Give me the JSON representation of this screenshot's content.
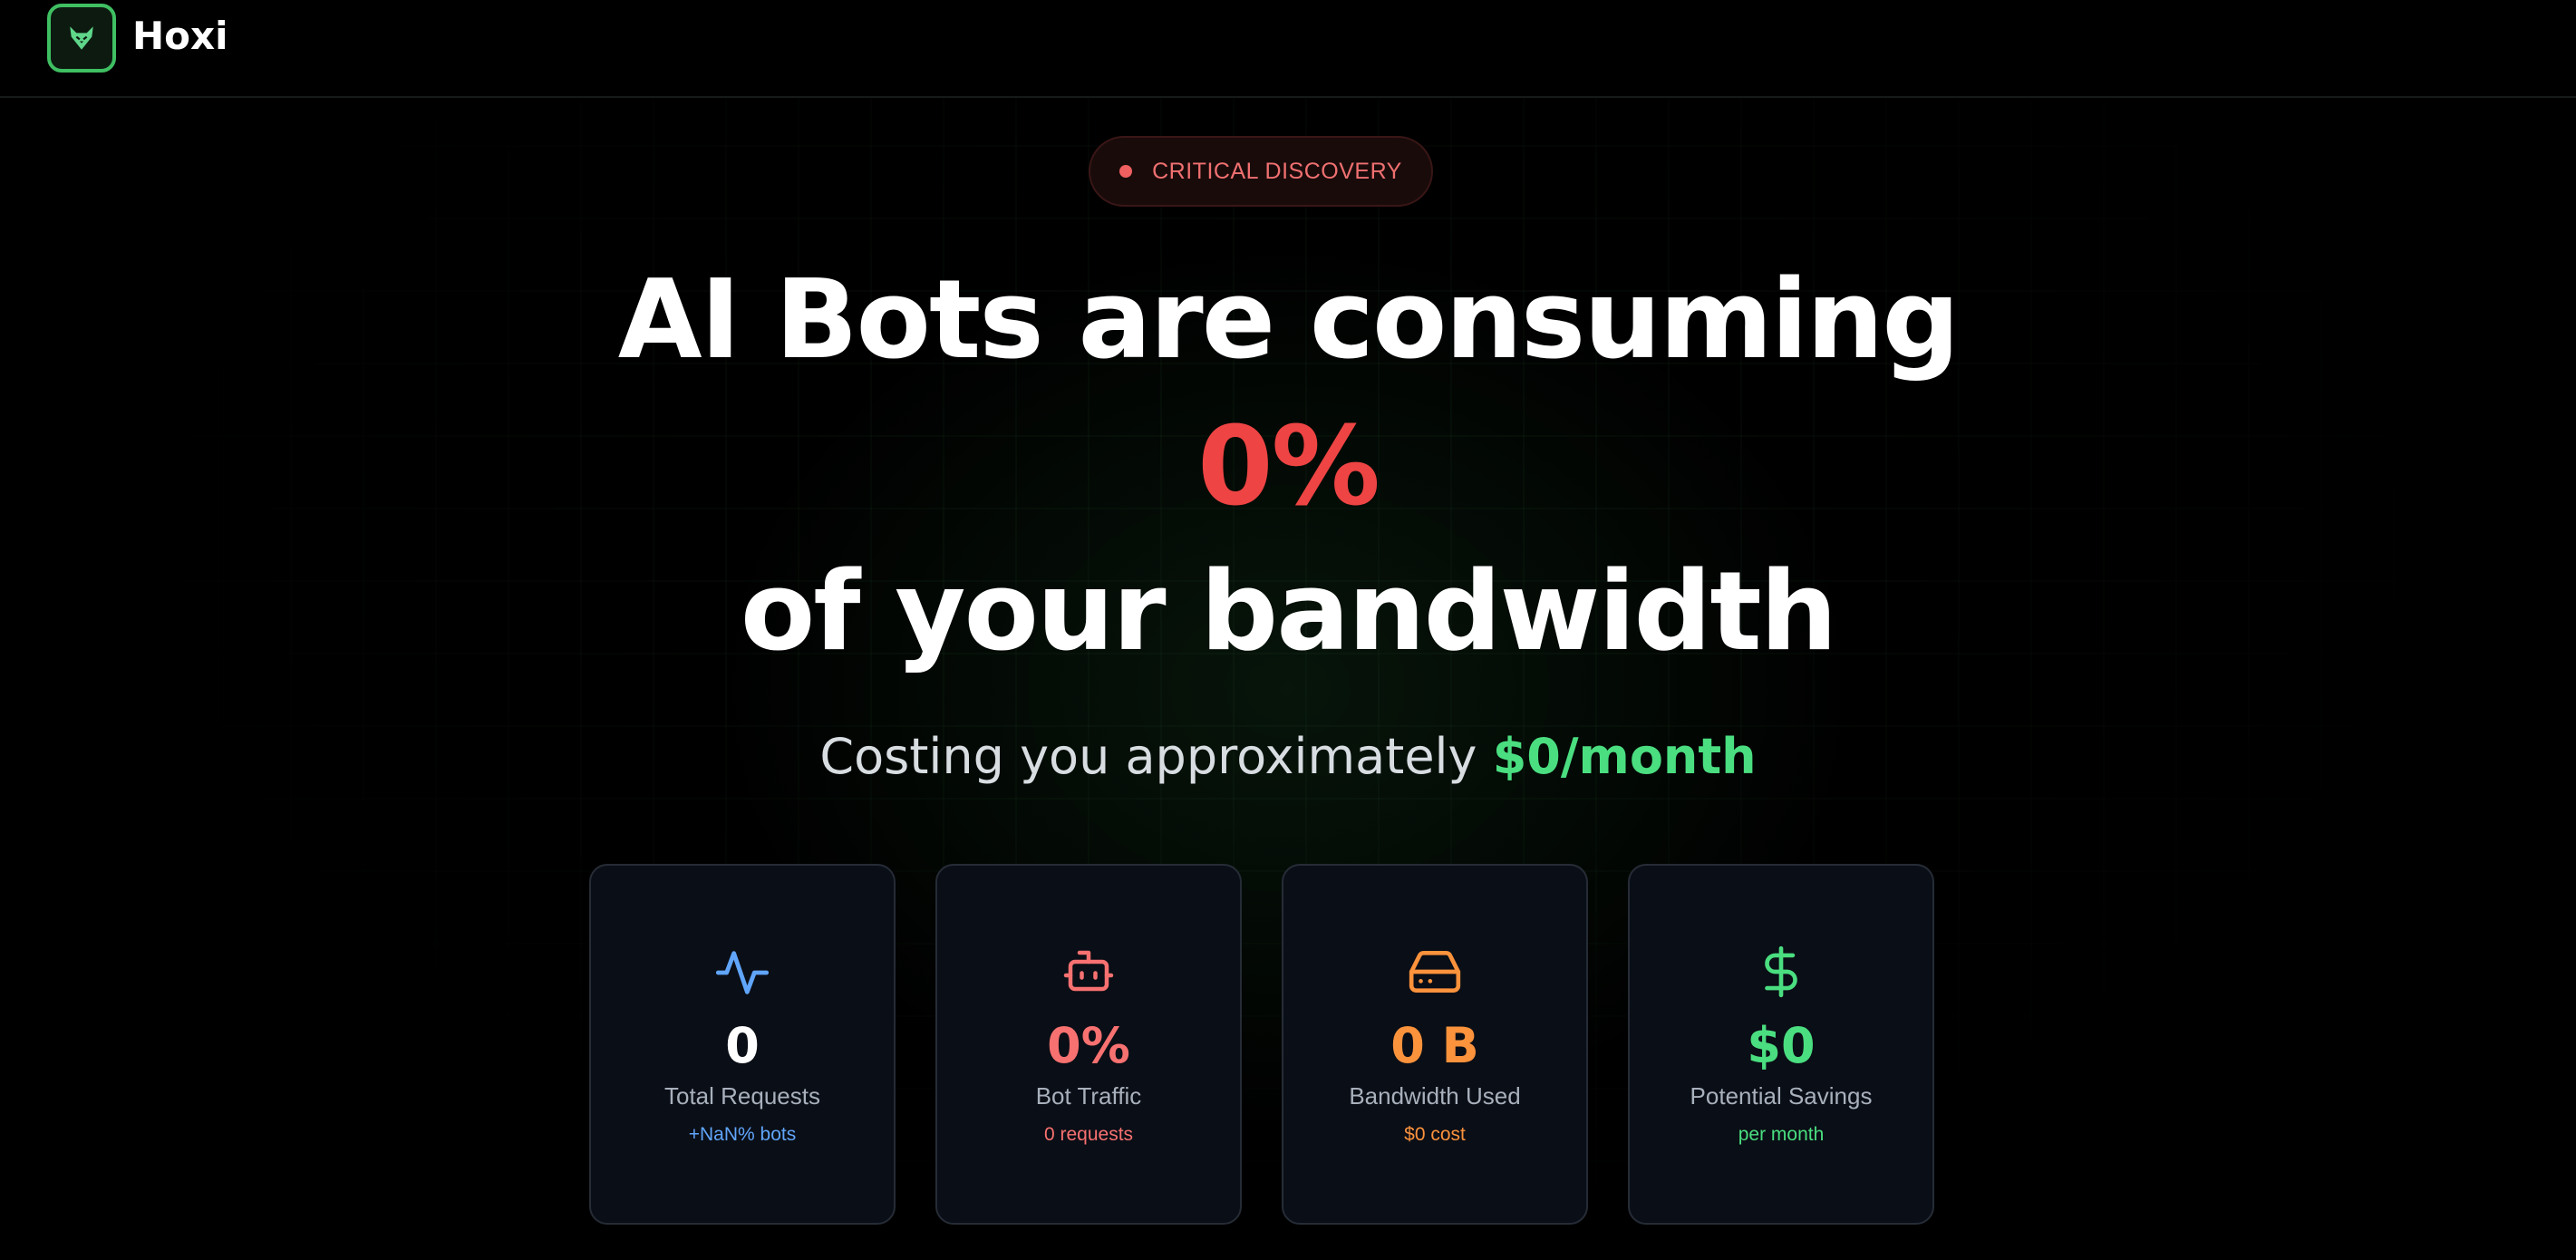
{
  "header": {
    "brand": "Hoxi",
    "logo_icon": "fox-icon",
    "accent": "#3fbf62"
  },
  "badge": {
    "text": "CRITICAL DISCOVERY",
    "color": "#f07070"
  },
  "headline": {
    "line1": "AI Bots are consuming",
    "percent": "0%",
    "line3": "of your bandwidth"
  },
  "subline": {
    "prefix": "Costing you approximately ",
    "amount": "$0/month"
  },
  "cards": [
    {
      "icon": "activity-icon",
      "value": "0",
      "label": "Total Requests",
      "sub": "+NaN% bots",
      "color": "#60a5fa"
    },
    {
      "icon": "bot-icon",
      "value": "0%",
      "label": "Bot Traffic",
      "sub": "0 requests",
      "color": "#f87171"
    },
    {
      "icon": "hard-drive-icon",
      "value": "0 B",
      "label": "Bandwidth Used",
      "sub": "$0 cost",
      "color": "#fb923c"
    },
    {
      "icon": "dollar-sign-icon",
      "value": "$0",
      "label": "Potential Savings",
      "sub": "per month",
      "color": "#4ade80"
    }
  ]
}
